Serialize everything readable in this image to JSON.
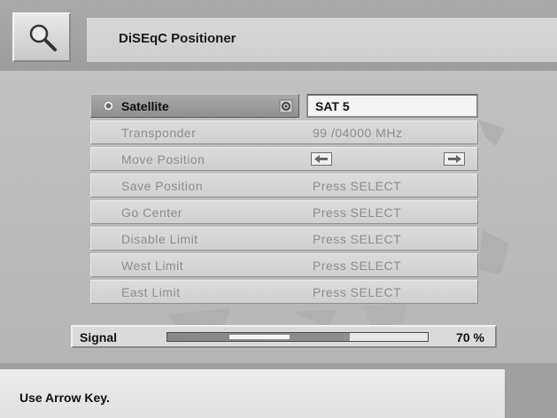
{
  "header": {
    "title": "DiSEqC Positioner",
    "icon": "magnifier-icon"
  },
  "menu": {
    "items": [
      {
        "label": "Satellite",
        "value": "SAT 5",
        "selected": true
      },
      {
        "label": "Transponder",
        "value": "99 /04000 MHz"
      },
      {
        "label": "Move Position",
        "value": ""
      },
      {
        "label": "Save Position",
        "value": "Press SELECT"
      },
      {
        "label": "Go Center",
        "value": "Press SELECT"
      },
      {
        "label": "Disable Limit",
        "value": "Press SELECT"
      },
      {
        "label": "West Limit",
        "value": "Press SELECT"
      },
      {
        "label": "East Limit",
        "value": "Press SELECT"
      }
    ]
  },
  "signal": {
    "label": "Signal",
    "level_percent": 70,
    "value_text": "70 %"
  },
  "footer": {
    "hint": "Use Arrow Key."
  }
}
